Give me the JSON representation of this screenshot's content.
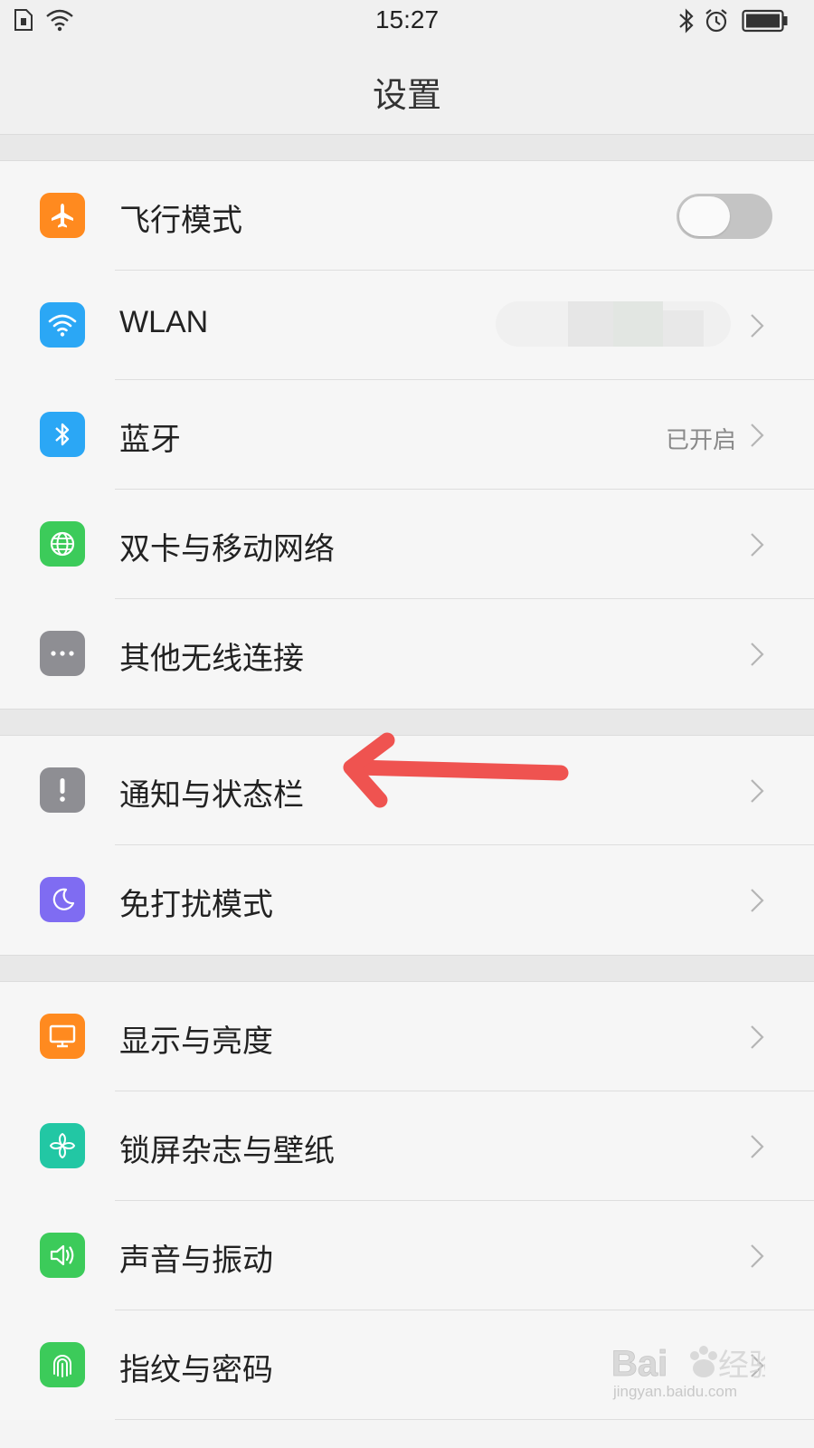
{
  "status_bar": {
    "time": "15:27",
    "icons": [
      "sim-icon",
      "wifi-icon",
      "bluetooth-icon",
      "alarm-icon",
      "battery-icon"
    ]
  },
  "header": {
    "title": "设置"
  },
  "groups": [
    {
      "items": [
        {
          "label": "飞行模式",
          "icon": "airplane-icon",
          "color": "#ff8a1f",
          "control": "toggle",
          "toggle_on": false
        },
        {
          "label": "WLAN",
          "icon": "wifi-icon",
          "color": "#2ba7f5",
          "control": "chevron"
        },
        {
          "label": "蓝牙",
          "icon": "bluetooth-icon",
          "color": "#2ba7f5",
          "value": "已开启",
          "control": "chevron"
        },
        {
          "label": "双卡与移动网络",
          "icon": "globe-icon",
          "color": "#3ccb5a",
          "control": "chevron"
        },
        {
          "label": "其他无线连接",
          "icon": "more-icon",
          "color": "#8e8e93",
          "control": "chevron"
        }
      ]
    },
    {
      "items": [
        {
          "label": "通知与状态栏",
          "icon": "notification-icon",
          "color": "#8e8e93",
          "control": "chevron"
        },
        {
          "label": "免打扰模式",
          "icon": "moon-icon",
          "color": "#7f6cf2",
          "control": "chevron"
        }
      ]
    },
    {
      "items": [
        {
          "label": "显示与亮度",
          "icon": "display-icon",
          "color": "#ff8a1f",
          "control": "chevron"
        },
        {
          "label": "锁屏杂志与壁纸",
          "icon": "pinwheel-icon",
          "color": "#22c7a4",
          "control": "chevron"
        },
        {
          "label": "声音与振动",
          "icon": "speaker-icon",
          "color": "#3ccb5a",
          "control": "chevron"
        },
        {
          "label": "指纹与密码",
          "icon": "fingerprint-icon",
          "color": "#3ccb5a",
          "control": "chevron"
        }
      ]
    }
  ],
  "annotation": {
    "arrow_color": "#ef5350"
  },
  "watermark": {
    "text": "jingyan.baidu.com"
  }
}
